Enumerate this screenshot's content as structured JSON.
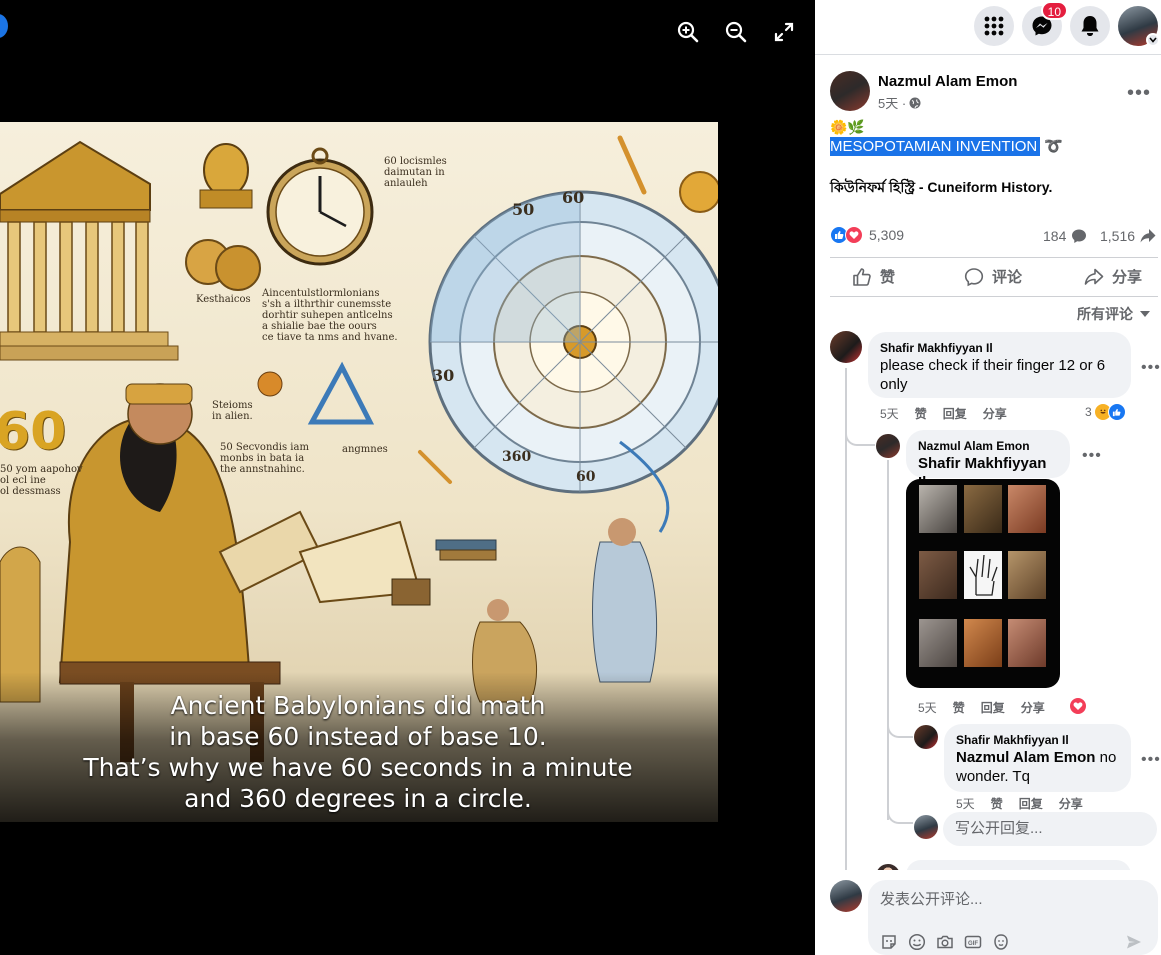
{
  "viewer": {
    "toolbar": {
      "zoom_in_icon": "zoom-in-icon",
      "zoom_out_icon": "zoom-out-icon",
      "fullscreen_icon": "fullscreen-icon"
    },
    "caption": [
      "Ancient Babylonians did math",
      "in base 60 instead of base 10.",
      "That’s why we have 60 seconds in a minute",
      "and 360 degrees in a circle."
    ],
    "image_labels": {
      "big_number": "60",
      "dial_numbers": [
        "60",
        "50",
        "30",
        "360",
        "60"
      ],
      "scrawl_1": "60 locismles\ndaimutan in\nanlauleh",
      "scrawl_2": "Aincentulstlormlonians\ns'sh a ilthrthir cunemsste\ndorhtir suhepen antlcelns\na shialie bae the oours\nce tiave ta nms and hvane.",
      "scrawl_3": "50 Secvondis iam\nmonbs in bata ia\nthe annstnahinc.",
      "scrawl_4": "Kesthaicos",
      "scrawl_5": "Steioms\nin alien.",
      "scrawl_6": "50 yom aapohov\nol ecl ine\nol dessmass",
      "scrawl_7": "angmnes"
    }
  },
  "header": {
    "messenger_badge": "10",
    "icons": [
      "menu-grid-icon",
      "messenger-icon",
      "bell-icon",
      "profile-avatar"
    ]
  },
  "post": {
    "author": "Nazmul Alam Emon",
    "time": "5天 ·",
    "emoji_line": "🌼🌿",
    "highlight_text": "MESOPOTAMIAN INVENTION",
    "trailing_emoji": "➰",
    "bengali_line": "কিউনিফর্ম হিস্ট্রি - Cuneiform History.",
    "reaction_count": "5,309",
    "comment_count": "184",
    "share_count": "1,516",
    "actions": {
      "like": "赞",
      "comment": "评论",
      "share": "分享"
    },
    "sort_label": "所有评论"
  },
  "comments": [
    {
      "author": "Shafir Makhfiyyan Il",
      "text": "please check if their finger 12 or 6 only",
      "time": "5天",
      "like": "赞",
      "reply": "回复",
      "share": "分享",
      "reaction_count": "3"
    },
    {
      "author": "Nazmul Alam Emon",
      "mention": "Shafir Makhfiyyan Il",
      "time": "5天",
      "like": "赞",
      "reply": "回复",
      "share": "分享"
    },
    {
      "author": "Shafir Makhfiyyan Il",
      "mention": "Nazmul Alam Emon",
      "text": "no wonder. Tq",
      "time": "5天",
      "like": "赞",
      "reply": "回复",
      "share": "分享"
    }
  ],
  "reply_placeholder": "写公开回复...",
  "compose_placeholder": "发表公开评论...",
  "compose_tools": [
    "sticker-icon",
    "emoji-icon",
    "camera-icon",
    "gif-icon",
    "avatar-sticker-icon"
  ],
  "colors": {
    "accent": "#1b74e4",
    "highlight": "#1a73e8",
    "badge": "#e41e3f",
    "bubble": "#f0f2f5"
  }
}
